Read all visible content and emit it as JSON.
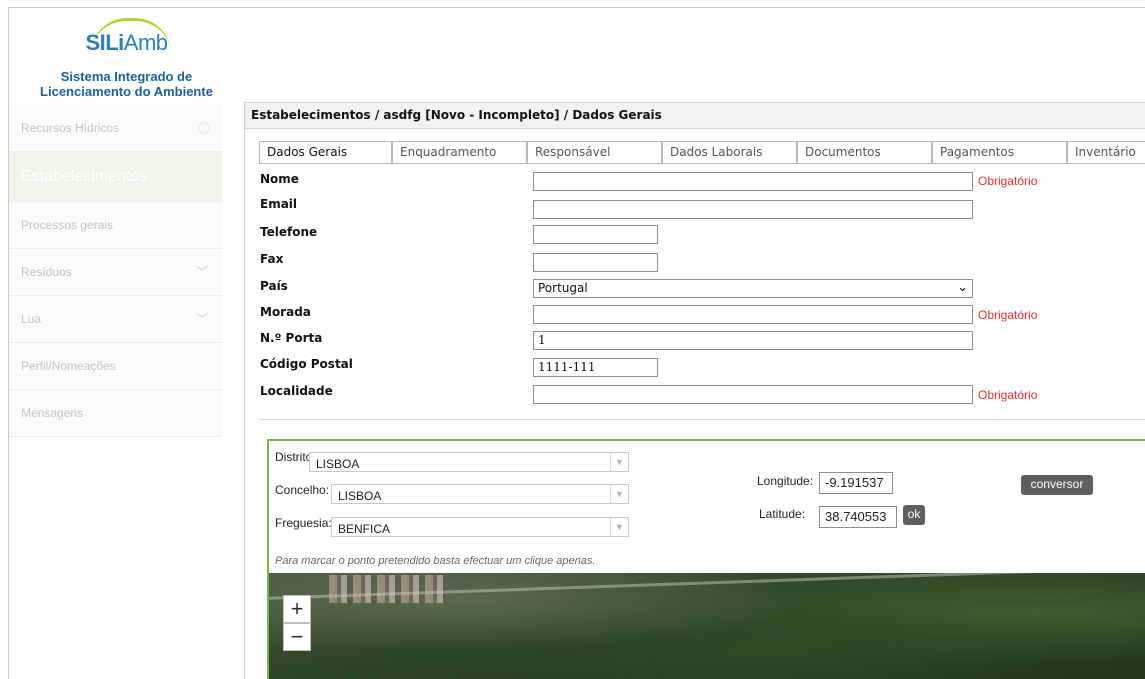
{
  "logo": {
    "brand_bold": "SILi",
    "brand_light": "Amb",
    "subtitle_1": "Sistema Integrado de",
    "subtitle_2": "Licenciamento do Ambiente"
  },
  "sidebar": {
    "items": [
      {
        "label": "Recursos Hídricos"
      },
      {
        "label": "Estabelecimentos"
      },
      {
        "label": "Processos gerais"
      },
      {
        "label": "Resíduos"
      },
      {
        "label": "Lua"
      },
      {
        "label": "Perfil/Nomeações"
      },
      {
        "label": "Mensagens"
      }
    ]
  },
  "breadcrumb": "Estabelecimentos / asdfg [Novo - Incompleto] / Dados Gerais",
  "tabs": [
    {
      "label": "Dados Gerais"
    },
    {
      "label": "Enquadramento"
    },
    {
      "label": "Responsável"
    },
    {
      "label": "Dados Laborais"
    },
    {
      "label": "Documentos"
    },
    {
      "label": "Pagamentos"
    },
    {
      "label": "Inventário"
    }
  ],
  "form": {
    "required_text": "Obrigatório",
    "nome": {
      "label": "Nome",
      "value": ""
    },
    "email": {
      "label": "Email",
      "value": ""
    },
    "telefone": {
      "label": "Telefone",
      "value": ""
    },
    "fax": {
      "label": "Fax",
      "value": ""
    },
    "pais": {
      "label": "País",
      "value": "Portugal"
    },
    "morada": {
      "label": "Morada",
      "value": ""
    },
    "porta": {
      "label": "N.º Porta",
      "value": "1"
    },
    "codigo_postal": {
      "label": "Código Postal",
      "value": "1111-111"
    },
    "localidade": {
      "label": "Localidade",
      "value": ""
    }
  },
  "location": {
    "distrito": {
      "label": "Distrito:",
      "value": "LISBOA"
    },
    "concelho": {
      "label": "Concelho:",
      "value": "LISBOA"
    },
    "freguesia": {
      "label": "Freguesia:",
      "value": "BENFICA"
    },
    "longitude": {
      "label": "Longitude:",
      "value": "-9.191537"
    },
    "latitude": {
      "label": "Latitude:",
      "value": "38.740553"
    },
    "ok_label": "ok",
    "conversor_label": "conversor",
    "hint": "Para marcar o ponto pretendido basta efectuar um clique apenas."
  },
  "map": {
    "zoom_in": "+",
    "zoom_out": "−"
  }
}
